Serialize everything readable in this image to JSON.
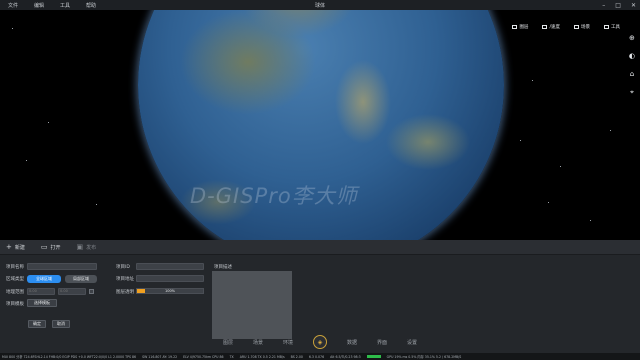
{
  "menu": {
    "items": [
      "文件",
      "编辑",
      "工具",
      "帮助"
    ],
    "title": "球体"
  },
  "window_controls": [
    "–",
    "□",
    "✕"
  ],
  "scene": {
    "watermark": "D-GISPro李大师",
    "toolbar": [
      {
        "label": "图层",
        "icon": "layers-icon"
      },
      {
        "label": "/速度",
        "icon": "speed-icon"
      },
      {
        "label": "场景",
        "icon": "scene-icon"
      },
      {
        "label": "工具",
        "icon": "tools-icon"
      }
    ],
    "side_icons": [
      "⊕",
      "◐",
      "⌂",
      "⌖"
    ]
  },
  "panel": {
    "toolbar": {
      "new_label": "新建",
      "open_label": "打开",
      "publish_label": "发布"
    },
    "form": {
      "project_name_label": "项目名称",
      "project_id_label": "项目ID",
      "area_type_label": "区域类型",
      "area_type_active": "全球区域",
      "area_type_other": "局部区域",
      "project_address_label": "项目地址",
      "geo_range_label": "地理范围",
      "geo_range_from": "0.00",
      "geo_range_to": "0.00",
      "layer_opacity_label": "图层透明",
      "opacity_value": "100%",
      "opacity_fraction": 0.12,
      "project_template_label": "项目模板",
      "template_button": "选择模板",
      "confirm_button": "确定",
      "cancel_button": "取消",
      "preview_label": "项目描述"
    }
  },
  "bottom_tabs": [
    "图层",
    "场景",
    "环境",
    "数据",
    "界面",
    "设置"
  ],
  "status": {
    "items": [
      "MUI 800  分析  724.6FSHL2.14  FHB:0/0   EGIP PDS  +0.0  WFT22:0/0/0   L1  2.0000   TPS  86",
      "SW  116.807  AY:  19.22",
      "ELV  4/9750.75km  CPU  86",
      "TX",
      "ARU  1.708  TX  0.5  2.21 MB/s",
      "BS  2.00",
      "6.3  0.076",
      "Alt  6.5/Ti/0.23  98:3"
    ],
    "right": "GPU  19%   ms  0.5%   内存 35.1%   5.2 / 678.2MB/S"
  }
}
